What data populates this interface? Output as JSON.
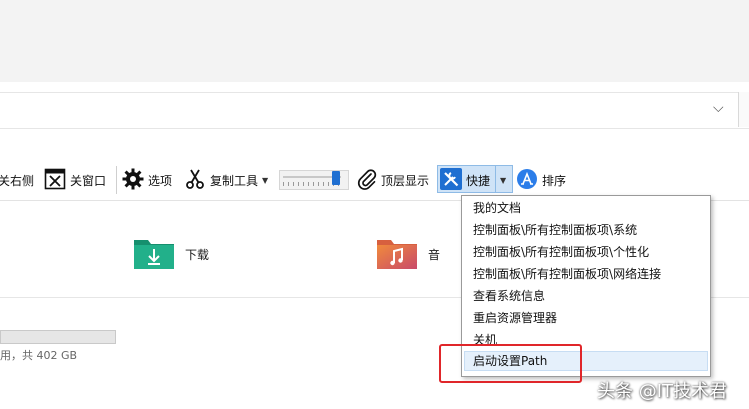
{
  "toolbar": {
    "close_right_label": "关右侧",
    "close_window_label": "关窗口",
    "options_label": "选项",
    "copy_tool_label": "复制工具",
    "pin_top_label": "顶层显示",
    "shortcut_label": "快捷",
    "sort_label": "排序",
    "opacity_slider_level": 0.92
  },
  "files": {
    "downloads_label": "下载",
    "music_label_partial": "音",
    "disk_text": "用，共 402 GB"
  },
  "menu": {
    "items": [
      "我的文档",
      "控制面板\\所有控制面板项\\系统",
      "控制面板\\所有控制面板项\\个性化",
      "控制面板\\所有控制面板项\\网络连接",
      "查看系统信息",
      "重启资源管理器",
      "关机",
      "启动设置Path"
    ],
    "highlighted_index": 7
  },
  "watermark": "头条 @IT技术君",
  "colors": {
    "accent": "#1f6fd1",
    "highlight_box": "#e0262a",
    "shortcut_button_bg": "#cfe3f7",
    "downloads_folder": "#1f9e7a",
    "music_folder": "#e0664f"
  },
  "icons": {
    "close_window": "close-window-icon",
    "options": "gear-icon",
    "copy_tool": "scissors-icon",
    "pin_top": "paperclip-icon",
    "shortcut": "tools-icon",
    "sort": "app-store-icon",
    "address_dropdown": "chevron-down-icon"
  }
}
